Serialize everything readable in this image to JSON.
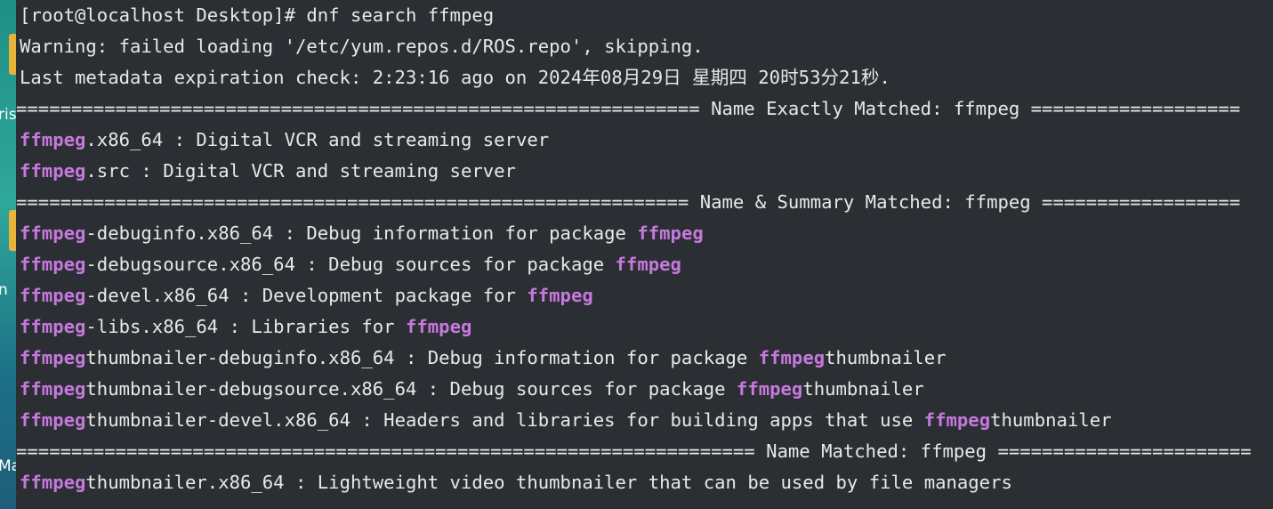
{
  "desktop": {
    "fragments": [
      "ris",
      "n",
      "Ma"
    ]
  },
  "terminal": {
    "prompt_line": "[root@localhost Desktop]# dnf search ffmpeg",
    "warning_line": "Warning: failed loading '/etc/yum.repos.d/ROS.repo', skipping.",
    "metadata_line": "Last metadata expiration check: 2:23:16 ago on 2024年08月29日 星期四 20时53分21秒.",
    "sections": [
      {
        "header": "============================================================== Name Exactly Matched: ffmpeg ===================",
        "entries": [
          {
            "parts": [
              {
                "t": "ffmpeg",
                "hl": true
              },
              {
                "t": ".x86_64 : Digital VCR and streaming server",
                "hl": false
              }
            ]
          },
          {
            "parts": [
              {
                "t": "ffmpeg",
                "hl": true
              },
              {
                "t": ".src : Digital VCR and streaming server",
                "hl": false
              }
            ]
          }
        ]
      },
      {
        "header": "============================================================= Name & Summary Matched: ffmpeg ==================",
        "entries": [
          {
            "parts": [
              {
                "t": "ffmpeg",
                "hl": true
              },
              {
                "t": "-debuginfo.x86_64 : Debug information for package ",
                "hl": false
              },
              {
                "t": "ffmpeg",
                "hl": true
              }
            ]
          },
          {
            "parts": [
              {
                "t": "ffmpeg",
                "hl": true
              },
              {
                "t": "-debugsource.x86_64 : Debug sources for package ",
                "hl": false
              },
              {
                "t": "ffmpeg",
                "hl": true
              }
            ]
          },
          {
            "parts": [
              {
                "t": "ffmpeg",
                "hl": true
              },
              {
                "t": "-devel.x86_64 : Development package for ",
                "hl": false
              },
              {
                "t": "ffmpeg",
                "hl": true
              }
            ]
          },
          {
            "parts": [
              {
                "t": "ffmpeg",
                "hl": true
              },
              {
                "t": "-libs.x86_64 : Libraries for ",
                "hl": false
              },
              {
                "t": "ffmpeg",
                "hl": true
              }
            ]
          },
          {
            "parts": [
              {
                "t": "ffmpeg",
                "hl": true
              },
              {
                "t": "thumbnailer-debuginfo.x86_64 : Debug information for package ",
                "hl": false
              },
              {
                "t": "ffmpeg",
                "hl": true
              },
              {
                "t": "thumbnailer",
                "hl": false
              }
            ]
          },
          {
            "parts": [
              {
                "t": "ffmpeg",
                "hl": true
              },
              {
                "t": "thumbnailer-debugsource.x86_64 : Debug sources for package ",
                "hl": false
              },
              {
                "t": "ffmpeg",
                "hl": true
              },
              {
                "t": "thumbnailer",
                "hl": false
              }
            ]
          },
          {
            "parts": [
              {
                "t": "ffmpeg",
                "hl": true
              },
              {
                "t": "thumbnailer-devel.x86_64 : Headers and libraries for building apps that use ",
                "hl": false
              },
              {
                "t": "ffmpeg",
                "hl": true
              },
              {
                "t": "thumbnailer",
                "hl": false
              }
            ]
          }
        ]
      },
      {
        "header": "=================================================================== Name Matched: ffmpeg =======================",
        "entries": [
          {
            "parts": [
              {
                "t": "ffmpeg",
                "hl": true
              },
              {
                "t": "thumbnailer.x86_64 : Lightweight video thumbnailer that can be used by file managers",
                "hl": false
              }
            ]
          }
        ]
      }
    ]
  },
  "colors": {
    "background": "#2b2f34",
    "text": "#e8e8e8",
    "highlight": "#c678dd"
  }
}
